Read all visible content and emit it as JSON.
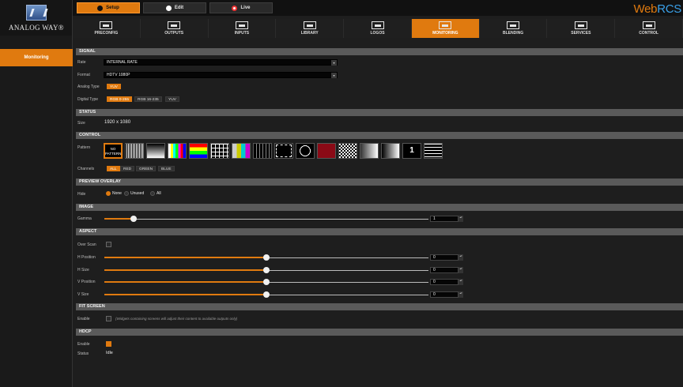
{
  "brand": {
    "logo_text": "ANALOG WAY®",
    "app_name_web": "Web",
    "app_name_rcs": "RCS"
  },
  "modes": [
    {
      "label": "Setup",
      "icon": "gear-icon",
      "active": true
    },
    {
      "label": "Edit",
      "icon": "pencil-icon",
      "active": false
    },
    {
      "label": "Live",
      "icon": "live-icon",
      "active": false
    }
  ],
  "nav": [
    {
      "label": "PRECONFIG",
      "icon": "preconfig-icon"
    },
    {
      "label": "OUTPUTS",
      "icon": "outputs-icon"
    },
    {
      "label": "INPUTS",
      "icon": "inputs-icon"
    },
    {
      "label": "LIBRARY",
      "icon": "library-icon"
    },
    {
      "label": "LOGOS",
      "icon": "logos-icon"
    },
    {
      "label": "MONITORING",
      "icon": "monitoring-icon",
      "active": true
    },
    {
      "label": "BLENDING",
      "icon": "blending-icon"
    },
    {
      "label": "SERVICES",
      "icon": "services-icon"
    },
    {
      "label": "CONTROL",
      "icon": "control-icon"
    }
  ],
  "sidebar": {
    "items": [
      {
        "label": "Monitoring",
        "active": true
      }
    ]
  },
  "signal": {
    "title": "SIGNAL",
    "rate_label": "Rate",
    "rate_value": "INTERNAL RATE",
    "format_label": "Format",
    "format_value": "HDTV 1080P",
    "analog_label": "Analog Type",
    "analog_option": "YUV",
    "digital_label": "Digital Type",
    "digital_options": [
      "RGB 0-255",
      "RGB 16-235",
      "YUV"
    ],
    "digital_selected": "RGB 0-255"
  },
  "status": {
    "title": "STATUS",
    "size_label": "Size",
    "size_value": "1920 x 1080"
  },
  "control": {
    "title": "CONTROL",
    "pattern_label": "Pattern",
    "selected_pattern": "NO PATTERN",
    "channels_label": "Channels",
    "channels": [
      "ALL",
      "RED",
      "GREEN",
      "BLUE"
    ],
    "channel_selected": "ALL"
  },
  "preview": {
    "title": "PREVIEW OVERLAY",
    "hide_label": "Hide",
    "options": [
      "None",
      "Unused",
      "All"
    ],
    "selected": "None"
  },
  "image": {
    "title": "IMAGE",
    "gamma_label": "Gamma",
    "gamma_value": "1",
    "gamma_level": 0.09
  },
  "aspect": {
    "title": "ASPECT",
    "overscan_label": "Over Scan",
    "overscan_checked": false,
    "hpos_label": "H Position",
    "hpos_value": "0",
    "hsize_label": "H Size",
    "hsize_value": "0",
    "vpos_label": "V Position",
    "vpos_value": "0",
    "vsize_label": "V Size",
    "vsize_value": "0",
    "slider_level": 0.5
  },
  "fit": {
    "title": "FIT SCREEN",
    "enable_label": "Enable",
    "enable_checked": false,
    "note": "(Widgets containing screens will adjust their content to available outputs only)"
  },
  "hdcp": {
    "title": "HDCP",
    "enable_label": "Enable",
    "enable_checked": true,
    "status_label": "Status",
    "status_value": "Idle"
  },
  "colors": {
    "accent": "#e07a0f",
    "section": "#5a5a5a",
    "background": "#1e1e1e"
  }
}
